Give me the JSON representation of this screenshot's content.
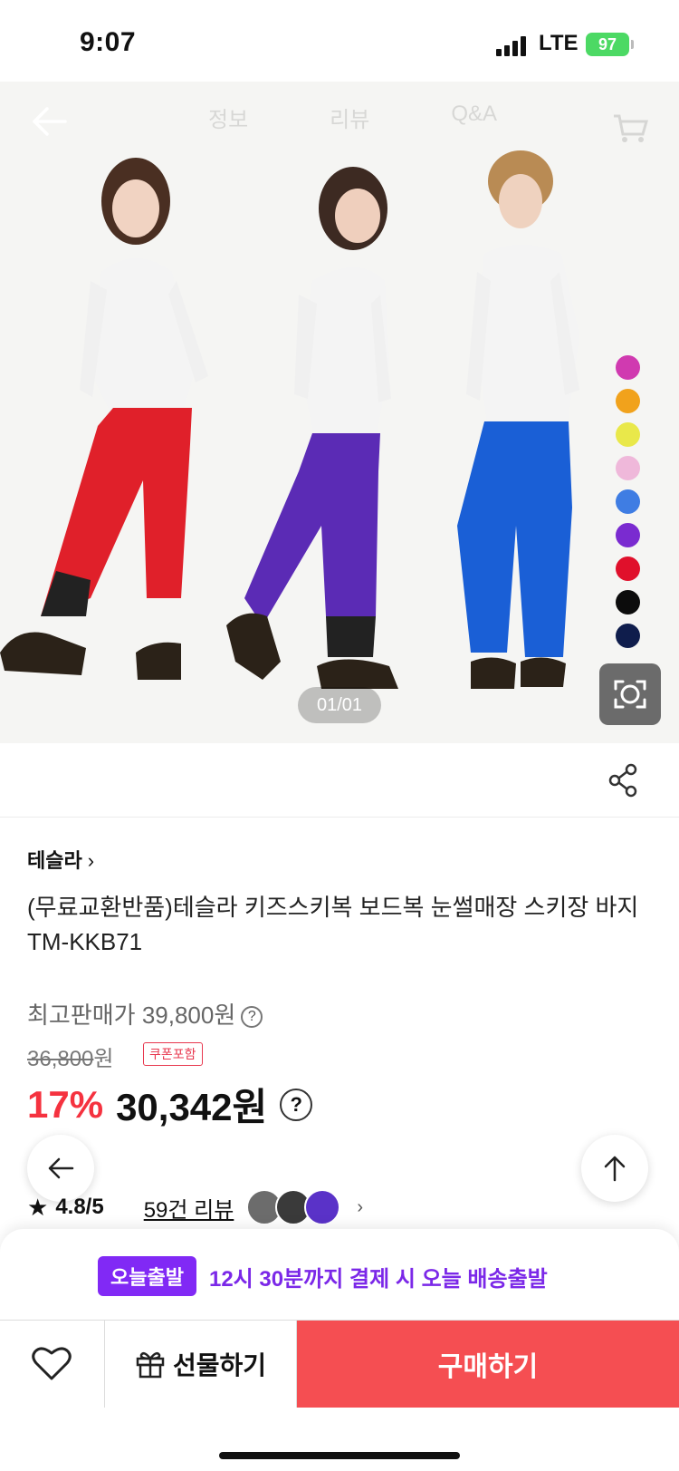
{
  "status_bar": {
    "time": "9:07",
    "network": "LTE",
    "battery": "97"
  },
  "hero": {
    "ghost_tabs": [
      "정보",
      "리뷰",
      "Q&A"
    ],
    "counter": "01/01",
    "swatch_colors": [
      "#d03ab0",
      "#f1a21c",
      "#e9e84a",
      "#efb8da",
      "#3f7de3",
      "#7a2bd0",
      "#e0102b",
      "#0c0c0c",
      "#0f1d4c"
    ],
    "model_pant_colors": [
      "#e0202a",
      "#5b2bb5",
      "#1a5fd6"
    ]
  },
  "product": {
    "brand": "테슬라",
    "title": "(무료교환반품)테슬라 키즈스키복 보드복 눈썰매장 스키장 바지TM-KKB71",
    "max_price_label": "최고판매가 39,800원",
    "original_price": "36,800",
    "original_price_unit": "원",
    "coupon_badge": "쿠폰포함",
    "discount": "17%",
    "sale_price": "30,342원"
  },
  "rating": {
    "score": "4.8/5",
    "reviews": "59건 리뷰",
    "thumb_colors": [
      "#6c6c6c",
      "#3a3a3a",
      "#5a32c8"
    ]
  },
  "delivery": {
    "tag": "오늘출발",
    "message": "12시 30분까지 결제 시 오늘 배송출발"
  },
  "actions": {
    "gift": "선물하기",
    "buy": "구매하기"
  }
}
